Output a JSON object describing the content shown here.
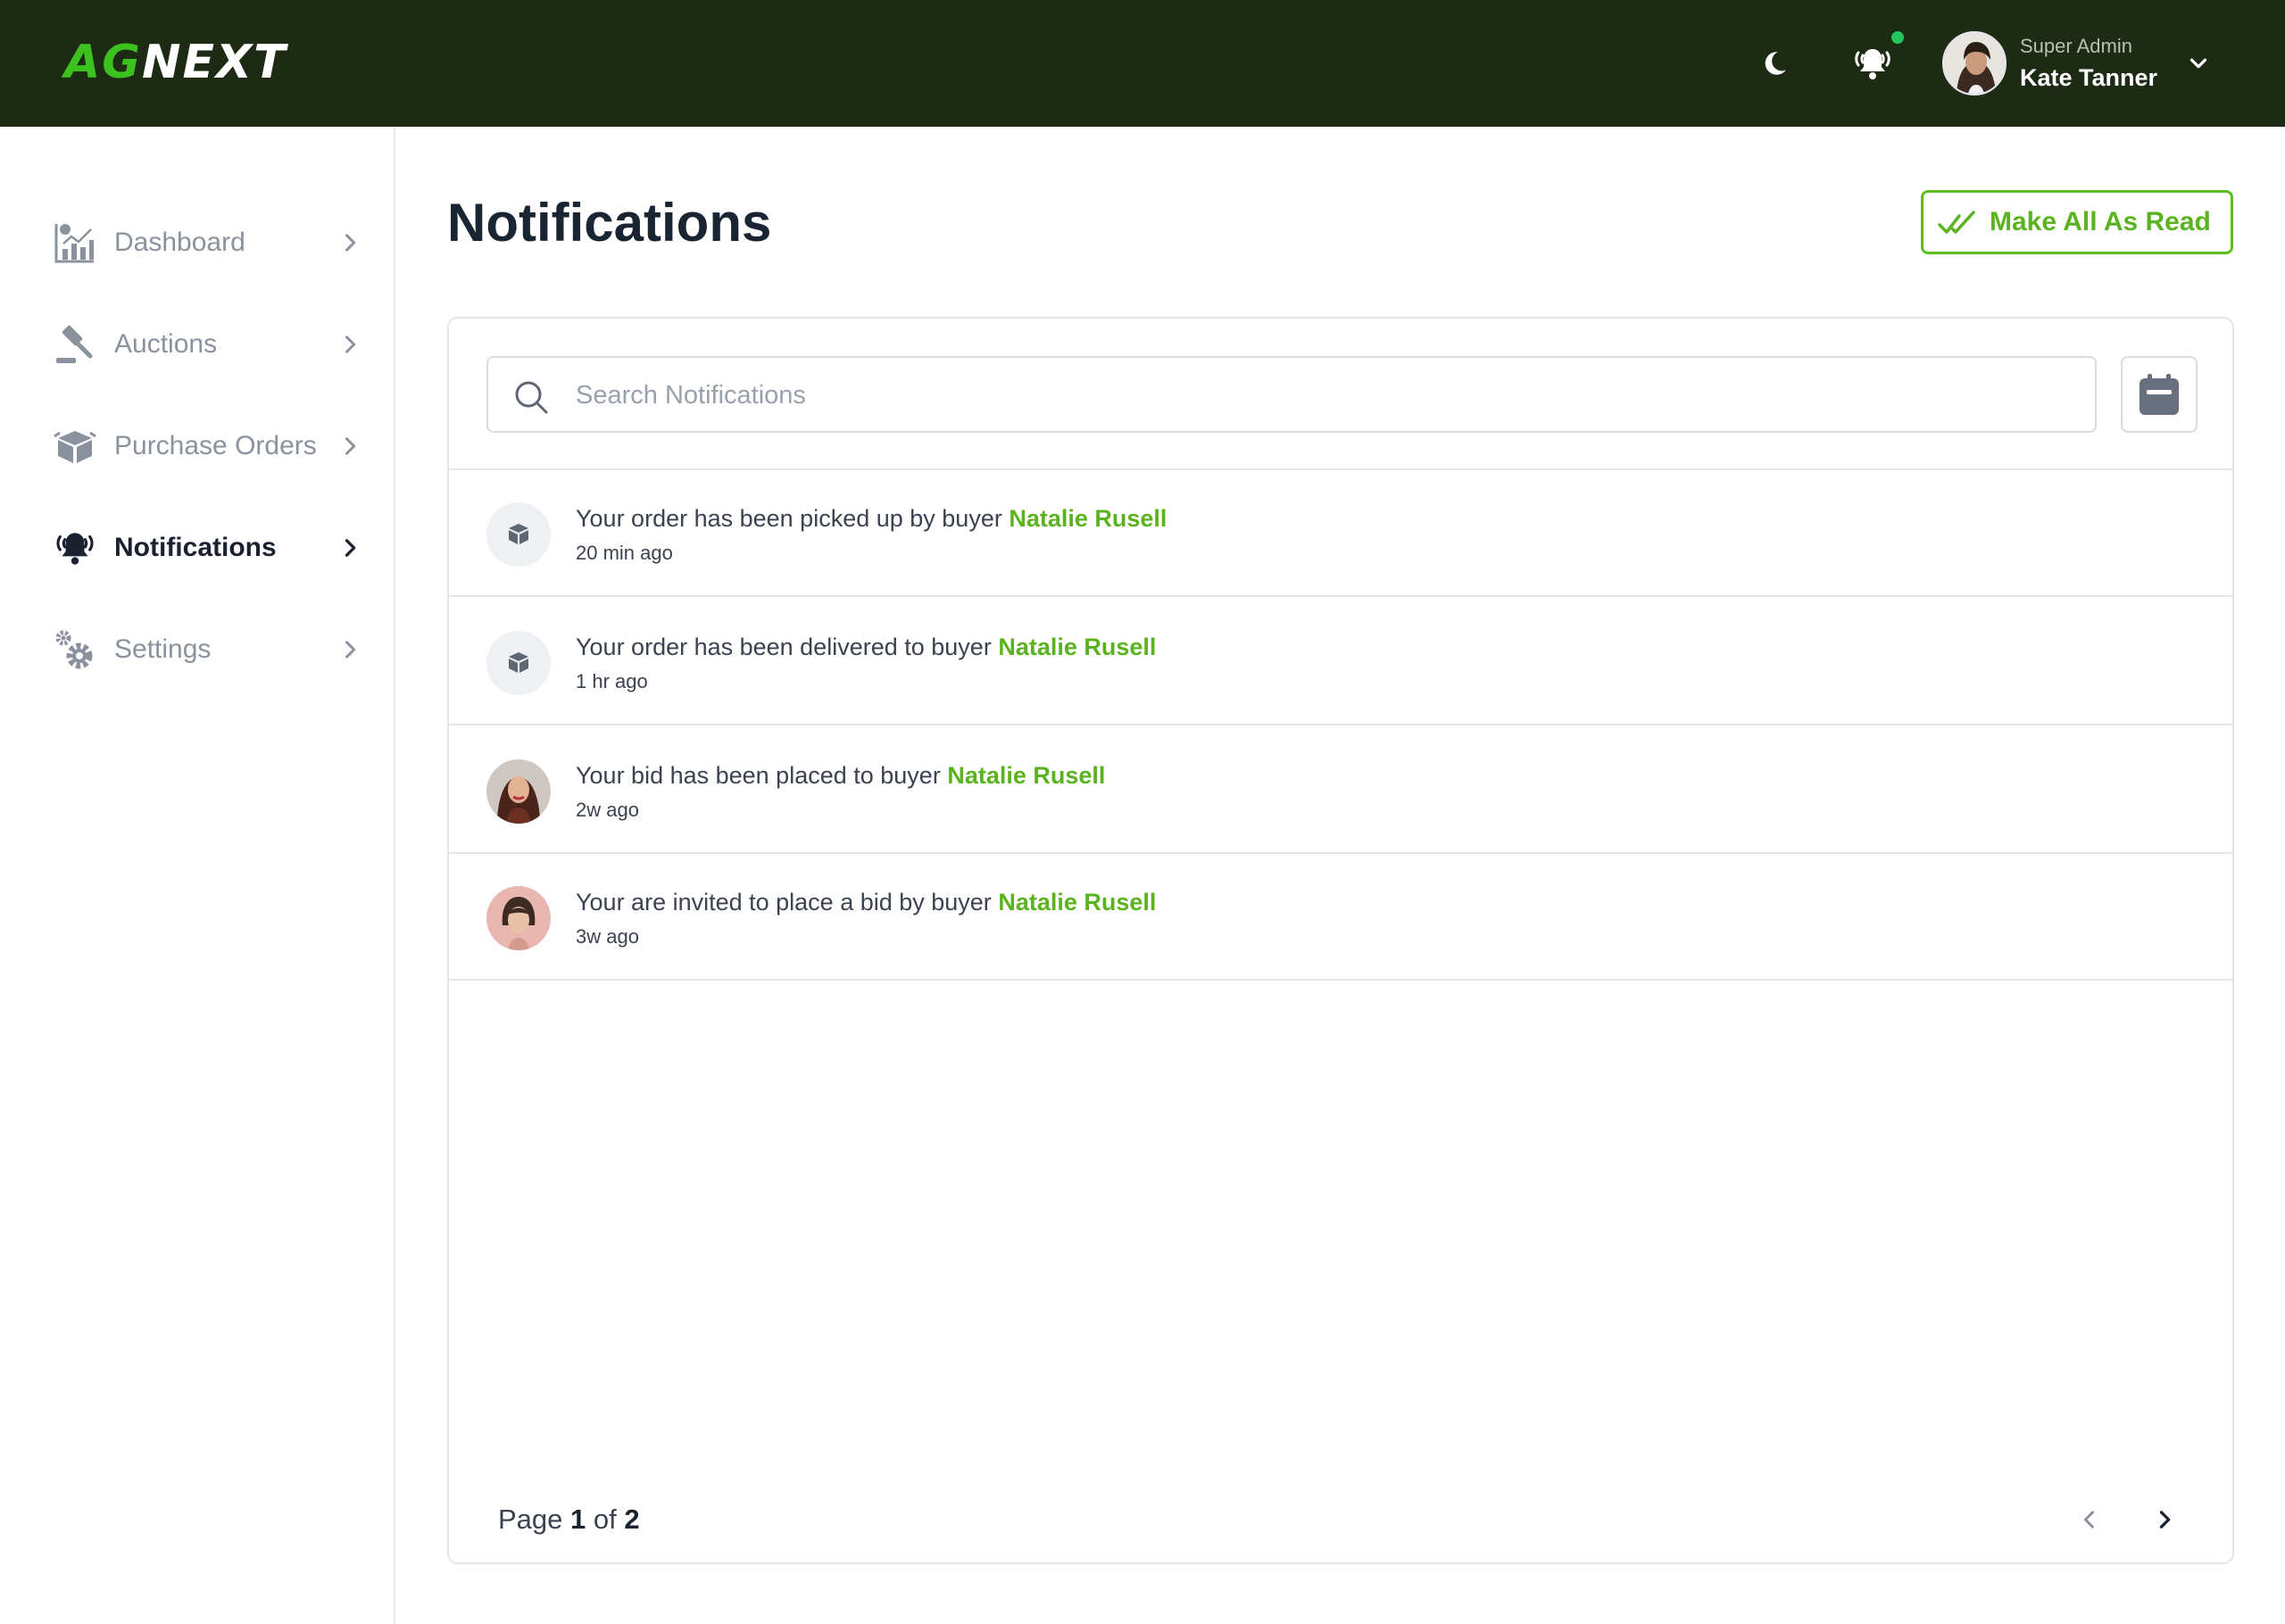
{
  "brand": {
    "logo_part1": "AG",
    "logo_part2": "NEXT"
  },
  "topbar": {
    "icons": [
      "moon-icon",
      "bell-icon"
    ],
    "has_unread_dot": true,
    "user": {
      "role": "Super Admin",
      "name": "Kate Tanner"
    }
  },
  "sidebar": {
    "items": [
      {
        "label": "Dashboard",
        "icon": "chart-icon",
        "active": false
      },
      {
        "label": "Auctions",
        "icon": "gavel-icon",
        "active": false
      },
      {
        "label": "Purchase Orders",
        "icon": "box-icon",
        "active": false
      },
      {
        "label": "Notifications",
        "icon": "bell-icon",
        "active": true
      },
      {
        "label": "Settings",
        "icon": "gear-icon",
        "active": false
      }
    ]
  },
  "main": {
    "title": "Notifications",
    "mark_all_label": "Make All As Read",
    "search": {
      "placeholder": "Search Notifications",
      "value": ""
    },
    "notifications": [
      {
        "text": "Your order has been picked up by buyer",
        "buyer": "Natalie Rusell",
        "time": "20 min ago",
        "icon": "box-icon"
      },
      {
        "text": "Your order has been delivered to buyer",
        "buyer": "Natalie Rusell",
        "time": "1 hr ago",
        "icon": "box-icon"
      },
      {
        "text": "Your bid has been placed to buyer",
        "buyer": "Natalie Rusell",
        "time": "2w ago",
        "icon": "avatar"
      },
      {
        "text": "Your are invited to place a bid by buyer",
        "buyer": "Natalie Rusell",
        "time": "3w ago",
        "icon": "avatar"
      }
    ],
    "pagination": {
      "prefix": "Page",
      "current": "1",
      "separator": "of",
      "total": "2"
    }
  },
  "colors": {
    "topbar": "#1e2b14",
    "accent": "#5bb31f",
    "logo_green": "#3cc21e",
    "unread_dot": "#22c55e"
  }
}
